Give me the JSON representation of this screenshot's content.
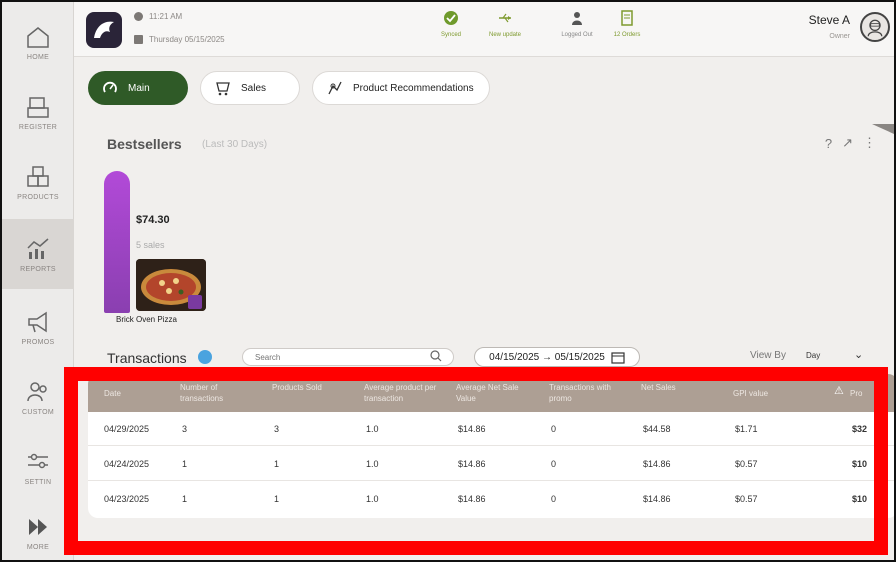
{
  "sidebar": {
    "items": [
      {
        "label": "HOME",
        "icon": "home-icon"
      },
      {
        "label": "REGISTER",
        "icon": "register-icon"
      },
      {
        "label": "PRODUCTS",
        "icon": "products-icon"
      },
      {
        "label": "REPORTS",
        "icon": "reports-icon",
        "active": true
      },
      {
        "label": "PROMOS",
        "icon": "megaphone-icon"
      },
      {
        "label": "CUSTOM",
        "icon": "customers-icon"
      },
      {
        "label": "SETTIN",
        "icon": "sliders-icon"
      },
      {
        "label": "MORE",
        "icon": "more-icon"
      }
    ]
  },
  "header": {
    "time": "11:21 AM",
    "date": "Thursday 05/15/2025",
    "statuses": [
      {
        "label": "Synced",
        "icon": "synced-check-icon"
      },
      {
        "label": "New update",
        "icon": "usb-update-icon"
      },
      {
        "label": "Logged Out",
        "icon": "person-icon"
      },
      {
        "label": "12 Orders",
        "icon": "orders-icon"
      }
    ],
    "user_name": "Steve A",
    "user_role": "Owner"
  },
  "tabs": [
    {
      "label": "Main",
      "icon": "dashboard-icon"
    },
    {
      "label": "Sales",
      "icon": "sales-icon"
    },
    {
      "label": "Product Recommendations",
      "icon": "recommendation-icon"
    }
  ],
  "bestsellers": {
    "title": "Bestsellers",
    "subtitle": "(Last 30 Days)",
    "items": [
      {
        "name": "Brick Oven Pizza",
        "value": "$74.30",
        "sales": "5 sales",
        "fill": 1.0
      }
    ]
  },
  "transactions": {
    "title": "Transactions",
    "search_placeholder": "Search",
    "date_range": "04/15/2025 → 05/15/2025",
    "view_by_label": "View By",
    "view_by_value": "Day",
    "columns": [
      "Date",
      "Number of transactions",
      "Products Sold",
      "Average product per transaction",
      "Average Net Sale Value",
      "Transactions with promo",
      "Net Sales",
      "GPI value",
      "Pro"
    ],
    "rows": [
      [
        "04/29/2025",
        "3",
        "3",
        "1.0",
        "$14.86",
        "0",
        "$44.58",
        "$1.71",
        "$32"
      ],
      [
        "04/24/2025",
        "1",
        "1",
        "1.0",
        "$14.86",
        "0",
        "$14.86",
        "$0.57",
        "$10"
      ],
      [
        "04/23/2025",
        "1",
        "1",
        "1.0",
        "$14.86",
        "0",
        "$14.86",
        "$0.57",
        "$10"
      ]
    ]
  },
  "colors": {
    "accent_green": "#2f5a27",
    "bar_purple": "#a547cc",
    "table_header": "#ad9f94",
    "highlight": "#ff0000"
  }
}
